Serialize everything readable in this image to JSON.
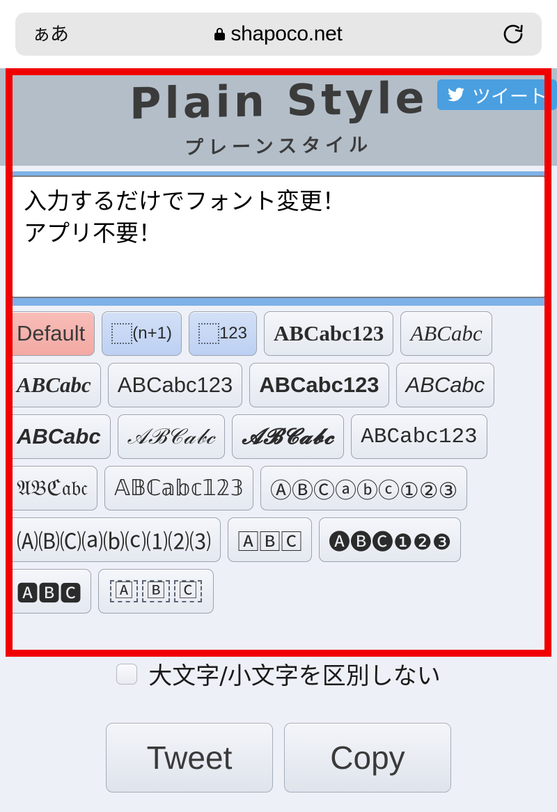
{
  "browser": {
    "text_size_button": "ぁあ",
    "lock_icon": "lock-icon",
    "url": "shapoco.net",
    "reload_icon": "reload-icon"
  },
  "app": {
    "title": "Plain Style",
    "subtitle": "プレーンスタイル",
    "tweet_badge": {
      "icon": "twitter-bird-icon",
      "label": "ツイート"
    }
  },
  "input": {
    "value": "入力するだけでフォント変更！\nアプリ不要！",
    "placeholder": ""
  },
  "style_buttons": {
    "rows": [
      [
        {
          "label": "Default",
          "kind": "selected",
          "font": "f-sans"
        },
        {
          "label": "(n+1)",
          "kind": "superscript",
          "font": "f-sans"
        },
        {
          "label": "123",
          "kind": "subscript",
          "font": "f-sans"
        },
        {
          "label": "ABCabc123",
          "kind": "normal",
          "font": "f-serif-b"
        },
        {
          "label": "ABCabc",
          "kind": "normal",
          "font": "f-serif-i"
        }
      ],
      [
        {
          "label": "ABCabc",
          "kind": "normal",
          "font": "f-serif-bi"
        },
        {
          "label": "ABCabc123",
          "kind": "normal",
          "font": "f-sans"
        },
        {
          "label": "ABCabc123",
          "kind": "normal",
          "font": "f-sans-b"
        },
        {
          "label": "ABCabc",
          "kind": "normal",
          "font": "f-sans-i"
        }
      ],
      [
        {
          "label": "ABCabc",
          "kind": "normal",
          "font": "f-sans-bi"
        },
        {
          "label": "𝒜ℬ𝒞𝒶𝒷𝒸",
          "kind": "normal",
          "font": "f-script"
        },
        {
          "label": "𝓐𝓑𝓒𝓪𝓫𝓬",
          "kind": "normal",
          "font": "f-script-b"
        },
        {
          "label": "ABCabc123",
          "kind": "normal",
          "font": "f-mono"
        }
      ],
      [
        {
          "label": "𝔄𝔅ℭ𝔞𝔟𝔠",
          "kind": "normal",
          "font": "f-uni"
        },
        {
          "label": "𝔸𝔹ℂ𝕒𝕓𝕔𝟙𝟚𝟛",
          "kind": "normal",
          "font": "f-uni"
        },
        {
          "label": "ⒶⒷⒸⓐⓑⓒ①②③",
          "kind": "normal",
          "font": "f-uni"
        }
      ],
      [
        {
          "label": "🄐🄑🄒⒜⒝⒞⑴⑵⑶",
          "kind": "normal",
          "font": "f-uni"
        },
        {
          "label": "🄰🄱🄲",
          "kind": "normal",
          "font": "f-uni"
        },
        {
          "label": "🅐🅑🅒❶❷❸",
          "kind": "normal",
          "font": "f-uni"
        }
      ],
      [
        {
          "label": "🅰🅱🅲",
          "kind": "normal",
          "font": "f-uni"
        },
        {
          "label": "🄰 🄱 🄲",
          "kind": "dashed",
          "font": "f-uni"
        }
      ]
    ]
  },
  "options": {
    "ignore_case": {
      "label": "大文字/小文字を区別しない",
      "checked": false
    }
  },
  "actions": {
    "tweet_label": "Tweet",
    "copy_label": "Copy"
  },
  "colors": {
    "annotation": "#f00000",
    "header_bg": "#b3bec9",
    "page_bg": "#eef0f7",
    "twitter_blue": "#4a9fe0",
    "selected_pink": "#f3a9a3",
    "focus_blue": "#7eb1e8"
  }
}
